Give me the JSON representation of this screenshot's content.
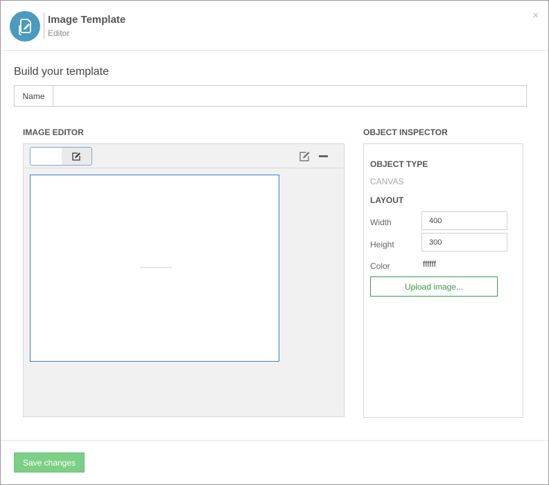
{
  "header": {
    "title": "Image Template",
    "subtitle": "Editor",
    "close_label": "×",
    "icon": "document-edit-icon"
  },
  "form": {
    "section_title": "Build your template",
    "name_label": "Name",
    "name_value": ""
  },
  "image_editor": {
    "title": "IMAGE EDITOR",
    "toolbar": {
      "edit_icon": "edit-icon",
      "minus_icon": "minus-icon"
    }
  },
  "inspector": {
    "title": "OBJECT INSPECTOR",
    "object_type_heading": "OBJECT TYPE",
    "object_type_value": "CANVAS",
    "layout_heading": "LAYOUT",
    "width_label": "Width",
    "width_value": "400",
    "height_label": "Height",
    "height_value": "300",
    "color_label": "Color",
    "color_value": "ffffff",
    "upload_label": "Upload image..."
  },
  "footer": {
    "save_label": "Save changes"
  },
  "colors": {
    "accent": "#4a9bbf",
    "success": "#3d9a48",
    "save_button": "#7ccf86",
    "canvas_border": "#3b7fc4"
  }
}
